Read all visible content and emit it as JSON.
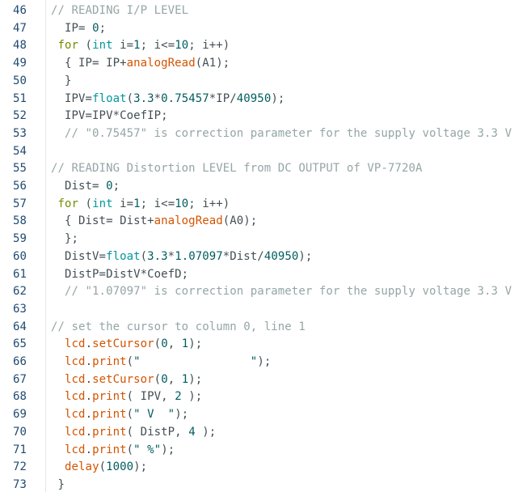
{
  "editor": {
    "colors": {
      "line_number": "#1f4a72",
      "comment": "#95a5a6",
      "keyword": "#728e00",
      "type": "#00979c",
      "function": "#d35400",
      "number": "#005c5f",
      "text": "#434f54"
    },
    "lines": [
      {
        "n": "46",
        "tokens": [
          {
            "t": "// READING I/P LEVEL",
            "c": "comment"
          }
        ]
      },
      {
        "n": "47",
        "tokens": [
          {
            "t": "  IP= ",
            "c": "id"
          },
          {
            "t": "0",
            "c": "num"
          },
          {
            "t": ";",
            "c": "id"
          }
        ]
      },
      {
        "n": "48",
        "tokens": [
          {
            "t": " ",
            "c": "id"
          },
          {
            "t": "for",
            "c": "kw"
          },
          {
            "t": " (",
            "c": "id"
          },
          {
            "t": "int",
            "c": "type"
          },
          {
            "t": " i=",
            "c": "id"
          },
          {
            "t": "1",
            "c": "num"
          },
          {
            "t": "; i<=",
            "c": "id"
          },
          {
            "t": "10",
            "c": "num"
          },
          {
            "t": "; i++)",
            "c": "id"
          }
        ]
      },
      {
        "n": "49",
        "tokens": [
          {
            "t": "  { IP= IP+",
            "c": "id"
          },
          {
            "t": "analogRead",
            "c": "fn"
          },
          {
            "t": "(A1);",
            "c": "id"
          }
        ]
      },
      {
        "n": "50",
        "tokens": [
          {
            "t": "  }",
            "c": "id"
          }
        ]
      },
      {
        "n": "51",
        "tokens": [
          {
            "t": "  IPV=",
            "c": "id"
          },
          {
            "t": "float",
            "c": "type"
          },
          {
            "t": "(",
            "c": "id"
          },
          {
            "t": "3.3",
            "c": "num"
          },
          {
            "t": "*",
            "c": "id"
          },
          {
            "t": "0.75457",
            "c": "num"
          },
          {
            "t": "*IP/",
            "c": "id"
          },
          {
            "t": "40950",
            "c": "num"
          },
          {
            "t": ");",
            "c": "id"
          }
        ]
      },
      {
        "n": "52",
        "tokens": [
          {
            "t": "  IPV=IPV*CoefIP;",
            "c": "id"
          }
        ]
      },
      {
        "n": "53",
        "tokens": [
          {
            "t": "  // \"0.75457\" is correction parameter for the supply voltage 3.3 V",
            "c": "comment"
          }
        ]
      },
      {
        "n": "54",
        "tokens": []
      },
      {
        "n": "55",
        "tokens": [
          {
            "t": "// READING Distortion LEVEL from DC OUTPUT of VP-7720A",
            "c": "comment"
          }
        ]
      },
      {
        "n": "56",
        "tokens": [
          {
            "t": "  Dist= ",
            "c": "id"
          },
          {
            "t": "0",
            "c": "num"
          },
          {
            "t": ";",
            "c": "id"
          }
        ]
      },
      {
        "n": "57",
        "tokens": [
          {
            "t": " ",
            "c": "id"
          },
          {
            "t": "for",
            "c": "kw"
          },
          {
            "t": " (",
            "c": "id"
          },
          {
            "t": "int",
            "c": "type"
          },
          {
            "t": " i=",
            "c": "id"
          },
          {
            "t": "1",
            "c": "num"
          },
          {
            "t": "; i<=",
            "c": "id"
          },
          {
            "t": "10",
            "c": "num"
          },
          {
            "t": "; i++)",
            "c": "id"
          }
        ]
      },
      {
        "n": "58",
        "tokens": [
          {
            "t": "  { Dist= Dist+",
            "c": "id"
          },
          {
            "t": "analogRead",
            "c": "fn"
          },
          {
            "t": "(A0);",
            "c": "id"
          }
        ]
      },
      {
        "n": "59",
        "tokens": [
          {
            "t": "  };",
            "c": "id"
          }
        ]
      },
      {
        "n": "60",
        "tokens": [
          {
            "t": "  DistV=",
            "c": "id"
          },
          {
            "t": "float",
            "c": "type"
          },
          {
            "t": "(",
            "c": "id"
          },
          {
            "t": "3.3",
            "c": "num"
          },
          {
            "t": "*",
            "c": "id"
          },
          {
            "t": "1.07097",
            "c": "num"
          },
          {
            "t": "*Dist/",
            "c": "id"
          },
          {
            "t": "40950",
            "c": "num"
          },
          {
            "t": ");",
            "c": "id"
          }
        ]
      },
      {
        "n": "61",
        "tokens": [
          {
            "t": "  DistP=DistV*CoefD;",
            "c": "id"
          }
        ]
      },
      {
        "n": "62",
        "tokens": [
          {
            "t": "  // \"1.07097\" is correction parameter for the supply voltage 3.3 V",
            "c": "comment"
          }
        ]
      },
      {
        "n": "63",
        "tokens": []
      },
      {
        "n": "64",
        "tokens": [
          {
            "t": "// set the cursor to column 0, line 1",
            "c": "comment"
          }
        ]
      },
      {
        "n": "65",
        "tokens": [
          {
            "t": "  ",
            "c": "id"
          },
          {
            "t": "lcd",
            "c": "fn"
          },
          {
            "t": ".",
            "c": "id"
          },
          {
            "t": "setCursor",
            "c": "fn"
          },
          {
            "t": "(",
            "c": "id"
          },
          {
            "t": "0",
            "c": "num"
          },
          {
            "t": ", ",
            "c": "id"
          },
          {
            "t": "1",
            "c": "num"
          },
          {
            "t": ");",
            "c": "id"
          }
        ]
      },
      {
        "n": "66",
        "tokens": [
          {
            "t": "  ",
            "c": "id"
          },
          {
            "t": "lcd",
            "c": "fn"
          },
          {
            "t": ".",
            "c": "id"
          },
          {
            "t": "print",
            "c": "fn"
          },
          {
            "t": "(",
            "c": "id"
          },
          {
            "t": "\"                \"",
            "c": "str"
          },
          {
            "t": ");",
            "c": "id"
          }
        ]
      },
      {
        "n": "67",
        "tokens": [
          {
            "t": "  ",
            "c": "id"
          },
          {
            "t": "lcd",
            "c": "fn"
          },
          {
            "t": ".",
            "c": "id"
          },
          {
            "t": "setCursor",
            "c": "fn"
          },
          {
            "t": "(",
            "c": "id"
          },
          {
            "t": "0",
            "c": "num"
          },
          {
            "t": ", ",
            "c": "id"
          },
          {
            "t": "1",
            "c": "num"
          },
          {
            "t": ");",
            "c": "id"
          }
        ]
      },
      {
        "n": "68",
        "tokens": [
          {
            "t": "  ",
            "c": "id"
          },
          {
            "t": "lcd",
            "c": "fn"
          },
          {
            "t": ".",
            "c": "id"
          },
          {
            "t": "print",
            "c": "fn"
          },
          {
            "t": "( IPV, ",
            "c": "id"
          },
          {
            "t": "2",
            "c": "num"
          },
          {
            "t": " );",
            "c": "id"
          }
        ]
      },
      {
        "n": "69",
        "tokens": [
          {
            "t": "  ",
            "c": "id"
          },
          {
            "t": "lcd",
            "c": "fn"
          },
          {
            "t": ".",
            "c": "id"
          },
          {
            "t": "print",
            "c": "fn"
          },
          {
            "t": "(",
            "c": "id"
          },
          {
            "t": "\" V  \"",
            "c": "str"
          },
          {
            "t": ");",
            "c": "id"
          }
        ]
      },
      {
        "n": "70",
        "tokens": [
          {
            "t": "  ",
            "c": "id"
          },
          {
            "t": "lcd",
            "c": "fn"
          },
          {
            "t": ".",
            "c": "id"
          },
          {
            "t": "print",
            "c": "fn"
          },
          {
            "t": "( DistP, ",
            "c": "id"
          },
          {
            "t": "4",
            "c": "num"
          },
          {
            "t": " );",
            "c": "id"
          }
        ]
      },
      {
        "n": "71",
        "tokens": [
          {
            "t": "  ",
            "c": "id"
          },
          {
            "t": "lcd",
            "c": "fn"
          },
          {
            "t": ".",
            "c": "id"
          },
          {
            "t": "print",
            "c": "fn"
          },
          {
            "t": "(",
            "c": "id"
          },
          {
            "t": "\" %\"",
            "c": "str"
          },
          {
            "t": ");",
            "c": "id"
          }
        ]
      },
      {
        "n": "72",
        "tokens": [
          {
            "t": "  ",
            "c": "id"
          },
          {
            "t": "delay",
            "c": "fn"
          },
          {
            "t": "(",
            "c": "id"
          },
          {
            "t": "1000",
            "c": "num"
          },
          {
            "t": ");",
            "c": "id"
          }
        ]
      },
      {
        "n": "73",
        "tokens": [
          {
            "t": " }",
            "c": "id"
          }
        ]
      }
    ]
  }
}
